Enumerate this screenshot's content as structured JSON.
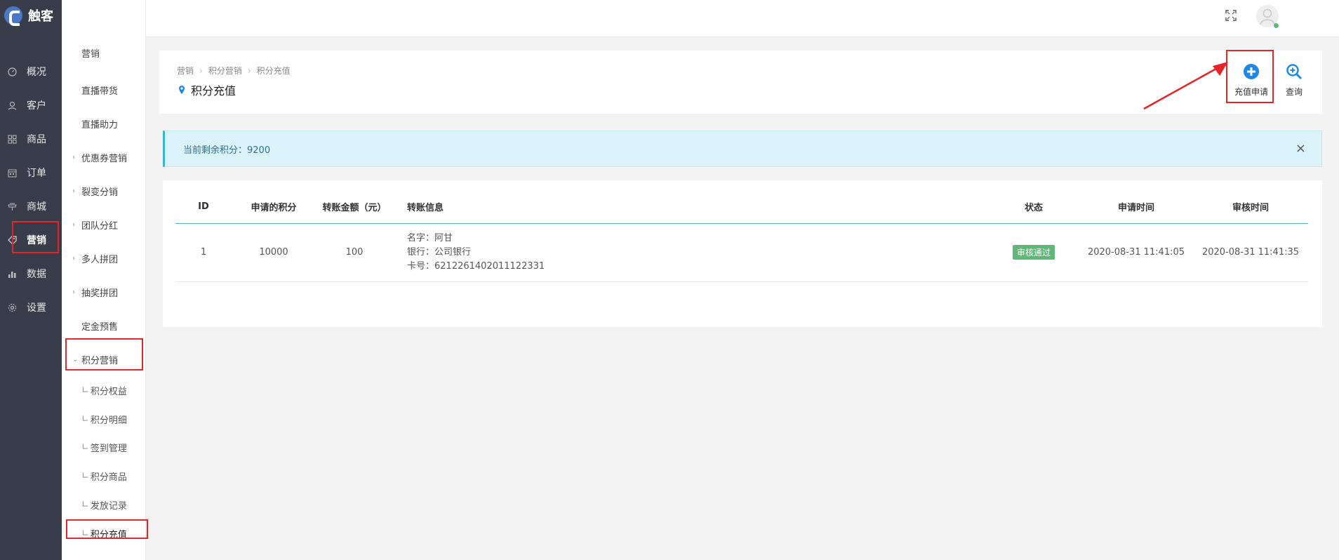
{
  "brand": {
    "name": "触客",
    "accent": "#4a78c6"
  },
  "nav_primary": {
    "items": [
      {
        "label": "概况",
        "icon": "gauge-icon"
      },
      {
        "label": "客户",
        "icon": "user-icon"
      },
      {
        "label": "商品",
        "icon": "grid-icon"
      },
      {
        "label": "订单",
        "icon": "calendar-icon"
      },
      {
        "label": "商城",
        "icon": "store-icon"
      },
      {
        "label": "营销",
        "icon": "tag-icon",
        "active": true
      },
      {
        "label": "数据",
        "icon": "bar-chart-icon"
      },
      {
        "label": "设置",
        "icon": "gear-icon"
      }
    ]
  },
  "nav_secondary": {
    "items": [
      {
        "label": "营销"
      },
      {
        "label": "直播带货"
      },
      {
        "label": "直播助力"
      },
      {
        "label": "优惠券营销",
        "arrow": "›"
      },
      {
        "label": "裂变分销",
        "arrow": "›"
      },
      {
        "label": "团队分红",
        "arrow": "›"
      },
      {
        "label": "多人拼团",
        "arrow": "›"
      },
      {
        "label": "抽奖拼团",
        "arrow": "›"
      },
      {
        "label": "定金预售"
      },
      {
        "label": "积分营销",
        "arrow": "⌄",
        "expanded": true
      }
    ],
    "sub_prefix": "∟",
    "subitems": [
      {
        "label": "积分权益"
      },
      {
        "label": "积分明细"
      },
      {
        "label": "签到管理"
      },
      {
        "label": "积分商品"
      },
      {
        "label": "发放记录"
      },
      {
        "label": "积分充值",
        "current": true
      }
    ]
  },
  "header": {
    "breadcrumb": [
      "营销",
      "积分营销",
      "积分充值"
    ],
    "breadcrumb_sep": "›",
    "title": "积分充值",
    "actions": {
      "apply_label": "充值申请",
      "query_label": "查询"
    }
  },
  "alert": {
    "text": "当前剩余积分：9200",
    "close": "×"
  },
  "table": {
    "columns": [
      "ID",
      "申请的积分",
      "转账金额（元）",
      "转账信息",
      "状态",
      "申请时间",
      "审核时间"
    ],
    "rows": [
      {
        "id": "1",
        "points": "10000",
        "amount": "100",
        "info": [
          "名字：阿甘",
          "银行：公司银行",
          "卡号：6212261402011122331"
        ],
        "status": "审核通过",
        "apply_time": "2020-08-31 11:41:05",
        "review_time": "2020-08-31 11:41:35"
      }
    ]
  },
  "colors": {
    "highlight": "#e5252a",
    "status_ok": "#5fb878",
    "action_blue": "#1e88e5",
    "sidebar_bg": "#393d49"
  }
}
